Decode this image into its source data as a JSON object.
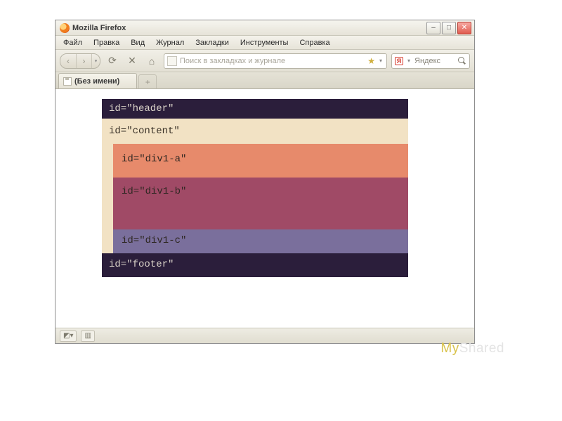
{
  "window": {
    "title": "Mozilla Firefox"
  },
  "menu": {
    "items": [
      "Файл",
      "Правка",
      "Вид",
      "Журнал",
      "Закладки",
      "Инструменты",
      "Справка"
    ]
  },
  "toolbar": {
    "url_placeholder": "Поиск в закладках и журнале",
    "search_provider": "Яндекс",
    "search_letter": "Я"
  },
  "tabs": {
    "active": "(Без имени)",
    "newtab_glyph": "+"
  },
  "layout": {
    "header": "id=\"header\"",
    "content": "id=\"content\"",
    "div_a": "id=\"div1-a\"",
    "div_b": "id=\"div1-b\"",
    "div_c": "id=\"div1-c\"",
    "footer": "id=\"footer\""
  },
  "watermark": {
    "prefix": "My",
    "suffix": "Shared"
  }
}
